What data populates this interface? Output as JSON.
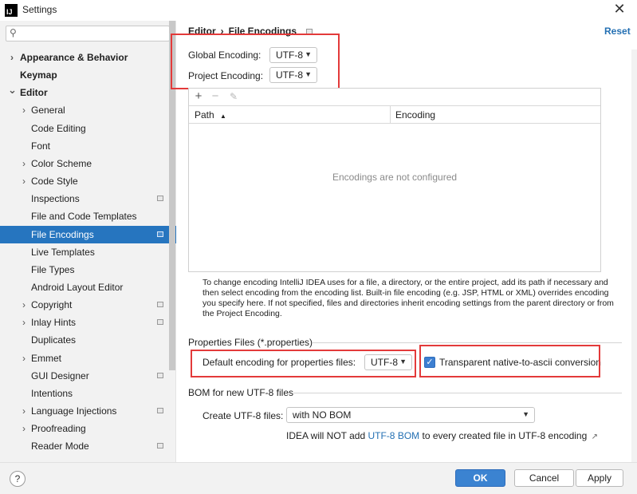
{
  "window": {
    "title": "Settings",
    "app_icon_text": "IJ"
  },
  "search": {
    "placeholder": "",
    "value": ""
  },
  "sidebar": {
    "items": [
      {
        "label": "Appearance & Behavior",
        "chevron": true,
        "bold": true
      },
      {
        "label": "Keymap",
        "chevron": false,
        "bold": true
      },
      {
        "label": "Editor",
        "chevron": true,
        "expanded": true,
        "bold": true
      },
      {
        "label": "General",
        "chevron": true
      },
      {
        "label": "Code Editing",
        "chevron": false
      },
      {
        "label": "Font",
        "chevron": false
      },
      {
        "label": "Color Scheme",
        "chevron": true
      },
      {
        "label": "Code Style",
        "chevron": true
      },
      {
        "label": "Inspections",
        "chevron": false,
        "project_icon": true
      },
      {
        "label": "File and Code Templates",
        "chevron": false
      },
      {
        "label": "File Encodings",
        "chevron": false,
        "project_icon": true,
        "selected": true
      },
      {
        "label": "Live Templates",
        "chevron": false
      },
      {
        "label": "File Types",
        "chevron": false
      },
      {
        "label": "Android Layout Editor",
        "chevron": false
      },
      {
        "label": "Copyright",
        "chevron": true,
        "project_icon": true
      },
      {
        "label": "Inlay Hints",
        "chevron": true,
        "project_icon": true
      },
      {
        "label": "Duplicates",
        "chevron": false
      },
      {
        "label": "Emmet",
        "chevron": true
      },
      {
        "label": "GUI Designer",
        "chevron": false,
        "project_icon": true
      },
      {
        "label": "Intentions",
        "chevron": false
      },
      {
        "label": "Language Injections",
        "chevron": true,
        "project_icon": true
      },
      {
        "label": "Proofreading",
        "chevron": true
      },
      {
        "label": "Reader Mode",
        "chevron": false,
        "project_icon": true
      }
    ]
  },
  "breadcrumb": {
    "parent": "Editor",
    "separator": "›",
    "current": "File Encodings"
  },
  "reset_label": "Reset",
  "global_encoding": {
    "label": "Global Encoding:",
    "value": "UTF-8"
  },
  "project_encoding": {
    "label": "Project Encoding:",
    "value": "UTF-8"
  },
  "table": {
    "toolbar": {
      "add": "+",
      "remove": "−",
      "edit": "✎"
    },
    "columns": {
      "path": "Path",
      "encoding": "Encoding"
    },
    "sort_indicator": "▲",
    "empty_text": "Encodings are not configured"
  },
  "help_text": "To change encoding IntelliJ IDEA uses for a file, a directory, or the entire project, add its path if necessary and then select encoding from the encoding list. Built-in file encoding (e.g. JSP, HTML or XML) overrides encoding you specify here. If not specified, files and directories inherit encoding settings from the parent directory or from the Project Encoding.",
  "properties": {
    "section_title": "Properties Files (*.properties)",
    "default_label": "Default encoding for properties files:",
    "default_value": "UTF-8",
    "transparent_label": "Transparent native-to-ascii conversion",
    "transparent_checked": true
  },
  "bom": {
    "section_title": "BOM for new UTF-8 files",
    "create_label": "Create UTF-8 files:",
    "create_value": "with NO BOM",
    "note_prefix": "IDEA will NOT add ",
    "note_link": "UTF-8 BOM",
    "note_suffix": " to every created file in UTF-8 encoding",
    "note_arrow": "↗"
  },
  "footer": {
    "help": "?",
    "ok": "OK",
    "cancel": "Cancel",
    "apply": "Apply"
  },
  "colors": {
    "accent": "#2675bf",
    "highlight_box": "#e33a3a",
    "link": "#2470b3"
  }
}
